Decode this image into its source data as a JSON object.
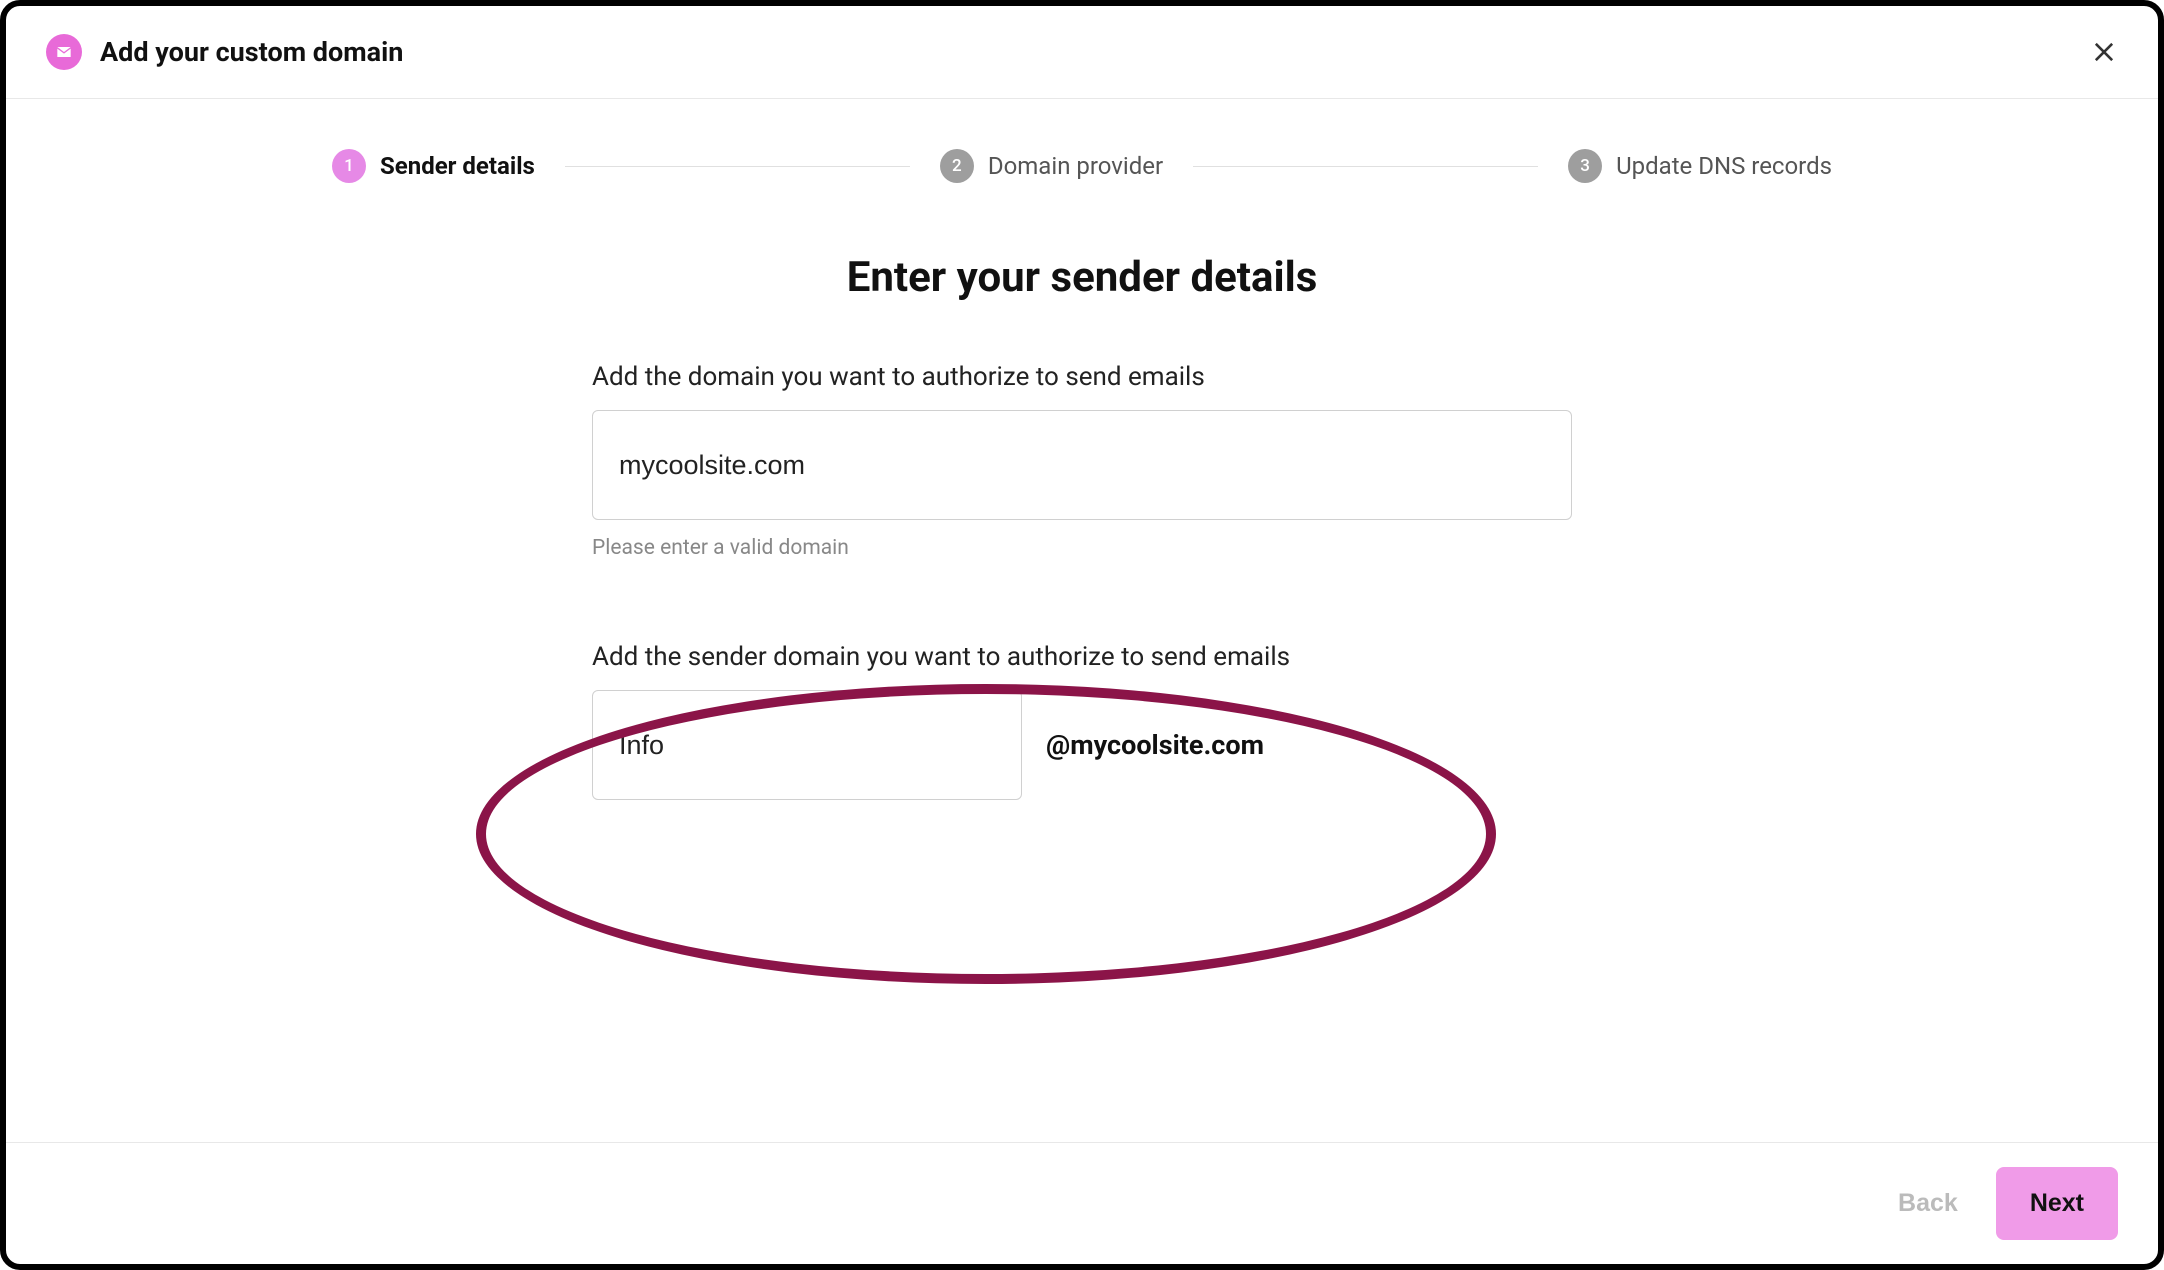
{
  "header": {
    "title": "Add your custom domain"
  },
  "stepper": {
    "steps": [
      {
        "number": "1",
        "label": "Sender details"
      },
      {
        "number": "2",
        "label": "Domain provider"
      },
      {
        "number": "3",
        "label": "Update DNS records"
      }
    ]
  },
  "main": {
    "heading": "Enter your sender details",
    "domain_field": {
      "label": "Add the domain you want to authorize to send emails",
      "value": "mycoolsite.com",
      "helper": "Please enter a valid domain"
    },
    "sender_field": {
      "label": "Add the sender domain you want to authorize to send emails",
      "value": "Info",
      "suffix": "@mycoolsite.com"
    }
  },
  "footer": {
    "back_label": "Back",
    "next_label": "Next"
  }
}
